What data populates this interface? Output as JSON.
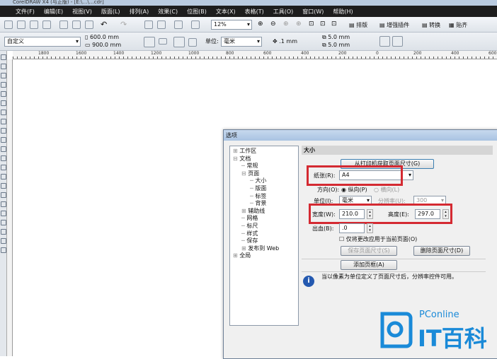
{
  "window": {
    "title": "CorelDRAW X4 (与正版) - [E:\\…\\…cdr]"
  },
  "menu": [
    "文件(F)",
    "编辑(E)",
    "视图(V)",
    "版面(L)",
    "排列(A)",
    "效果(C)",
    "位图(B)",
    "文本(X)",
    "表格(T)",
    "工具(O)",
    "窗口(W)",
    "帮助(H)"
  ],
  "toolbar": {
    "zoom": "12%",
    "plugins": [
      "排版",
      "增强插件",
      "转换",
      "贴齐"
    ]
  },
  "propbar": {
    "preset": "自定义",
    "width": "600.0 mm",
    "height": "900.0 mm",
    "unit_label": "单位:",
    "unit": "毫米",
    "nudge": ".1 mm",
    "dup_x": "5.0 mm",
    "dup_y": "5.0 mm"
  },
  "ruler": [
    "1800",
    "1600",
    "1400",
    "1200",
    "1000",
    "800",
    "600",
    "400",
    "200",
    "0",
    "200",
    "400",
    "600"
  ],
  "dialog": {
    "title": "选项",
    "tree": [
      {
        "label": "工作区",
        "level": 0,
        "exp": "⊞"
      },
      {
        "label": "文档",
        "level": 0,
        "exp": "⊟"
      },
      {
        "label": "常规",
        "level": 1,
        "exp": ""
      },
      {
        "label": "页面",
        "level": 1,
        "exp": "⊟"
      },
      {
        "label": "大小",
        "level": 2,
        "exp": ""
      },
      {
        "label": "版面",
        "level": 2,
        "exp": ""
      },
      {
        "label": "标签",
        "level": 2,
        "exp": ""
      },
      {
        "label": "背景",
        "level": 2,
        "exp": ""
      },
      {
        "label": "辅助线",
        "level": 1,
        "exp": "⊞"
      },
      {
        "label": "网格",
        "level": 1,
        "exp": ""
      },
      {
        "label": "标尺",
        "level": 1,
        "exp": ""
      },
      {
        "label": "样式",
        "level": 1,
        "exp": ""
      },
      {
        "label": "保存",
        "level": 1,
        "exp": ""
      },
      {
        "label": "发布到 Web",
        "level": 1,
        "exp": "⊞"
      },
      {
        "label": "全局",
        "level": 0,
        "exp": "⊞"
      }
    ],
    "section": "大小",
    "get_from_printer": "从打印机获取页面尺寸(G)",
    "paper_label": "纸张(R):",
    "paper": "A4",
    "orientation_label": "方向(O):",
    "portrait": "纵向(P)",
    "landscape": "横向(L)",
    "unit_label": "单位(I):",
    "unit": "毫米",
    "resolution_label": "分辨率(U):",
    "resolution": "300",
    "width_label": "宽度(W):",
    "width": "210.0",
    "height_label": "高度(E):",
    "height": "297.0",
    "bleed_label": "出血(B):",
    "bleed": ".0",
    "apply_current": "仅将更改应用于当前页面(O)",
    "save_size": "保存页面尺寸(S)",
    "delete_size": "删除页面尺寸(D)",
    "add_frame": "添加页框(A)",
    "info": "当以像素为单位定义了页面尺寸后，分辨率控件可用。"
  },
  "watermark": {
    "brand": "PConline",
    "text": "IT百科"
  },
  "colors": {
    "highlight": "#d42a32",
    "brand": "#1a8ad8"
  }
}
